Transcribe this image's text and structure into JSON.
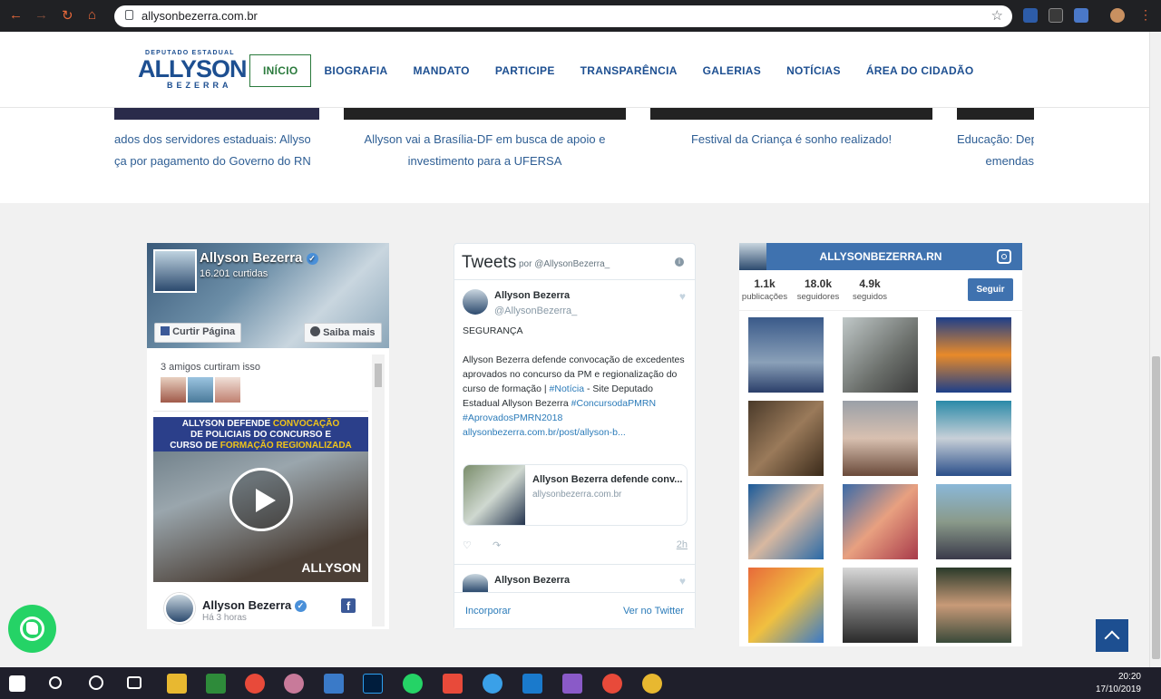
{
  "browser": {
    "url": "allysonbezerra.com.br"
  },
  "header": {
    "logo": {
      "top_text": "DEPUTADO ESTADUAL",
      "name": "ALLYSON",
      "subtitle": "BEZERRA"
    },
    "menu": [
      {
        "label": "INÍCIO",
        "active": true
      },
      {
        "label": "BIOGRAFIA"
      },
      {
        "label": "MANDATO"
      },
      {
        "label": "PARTICIPE"
      },
      {
        "label": "TRANSPARÊNCIA"
      },
      {
        "label": "GALERIAS"
      },
      {
        "label": "NOTÍCIAS"
      },
      {
        "label": "ÁREA DO CIDADÃO"
      }
    ]
  },
  "news": [
    {
      "line1": "ados dos servidores estaduais: Allyson",
      "line2": "ça por pagamento do Governo do RN"
    },
    {
      "line1": "Allyson vai a Brasília-DF em busca de apoio e",
      "line2": "investimento para a UFERSA"
    },
    {
      "line1": "Festival da Criança é sonho realizado!",
      "line2": ""
    },
    {
      "line1": "Educação: Dep",
      "line2": "emendas"
    }
  ],
  "facebook": {
    "page_name": "Allyson Bezerra",
    "likes": "16.201 curtidas",
    "like_button": "Curtir Página",
    "learn_more": "Saiba mais",
    "friends_text": "3 amigos curtiram isso",
    "video_title_1": "ALLYSON DEFENDE",
    "video_title_2": "CONVOCAÇÃO",
    "video_title_3": "DE POLICIAIS DO CONCURSO E",
    "video_title_4": "CURSO DE",
    "video_title_5": "FORMAÇÃO REGIONALIZADA",
    "video_logo": "ALLYSON",
    "post_name": "Allyson Bezerra",
    "post_time": "Há 3 horas"
  },
  "twitter": {
    "title": "Tweets",
    "by": "por @AllysonBezerra_",
    "tweet": {
      "name": "Allyson Bezerra",
      "handle": "@AllysonBezerra_",
      "line1": "SEGURANÇA",
      "text_a": "Allyson Bezerra defende convocação de excedentes aprovados no concurso da PM e regionalização do curso de formação |",
      "hashtag1": "#Notícia",
      "text_b": "- Site Deputado Estadual Allyson Bezerra",
      "hashtag2": "#ConcursodaPMRN",
      "hashtag3": "#AprovadosPMRN2018",
      "link": "allysonbezerra.com.br/post/allyson-b...",
      "card_title": "Allyson Bezerra defende conv...",
      "card_domain": "allysonbezerra.com.br",
      "time": "2h"
    },
    "tweet2_name": "Allyson Bezerra",
    "embed": "Incorporar",
    "view": "Ver no Twitter"
  },
  "instagram": {
    "username": "ALLYSONBEZERRA.RN",
    "stats": [
      {
        "value": "1.1k",
        "label": "publicações"
      },
      {
        "value": "18.0k",
        "label": "seguidores"
      },
      {
        "value": "4.9k",
        "label": "seguidos"
      }
    ],
    "follow": "Seguir"
  },
  "taskbar": {
    "time": "20:20",
    "date": "17/10/2019"
  }
}
